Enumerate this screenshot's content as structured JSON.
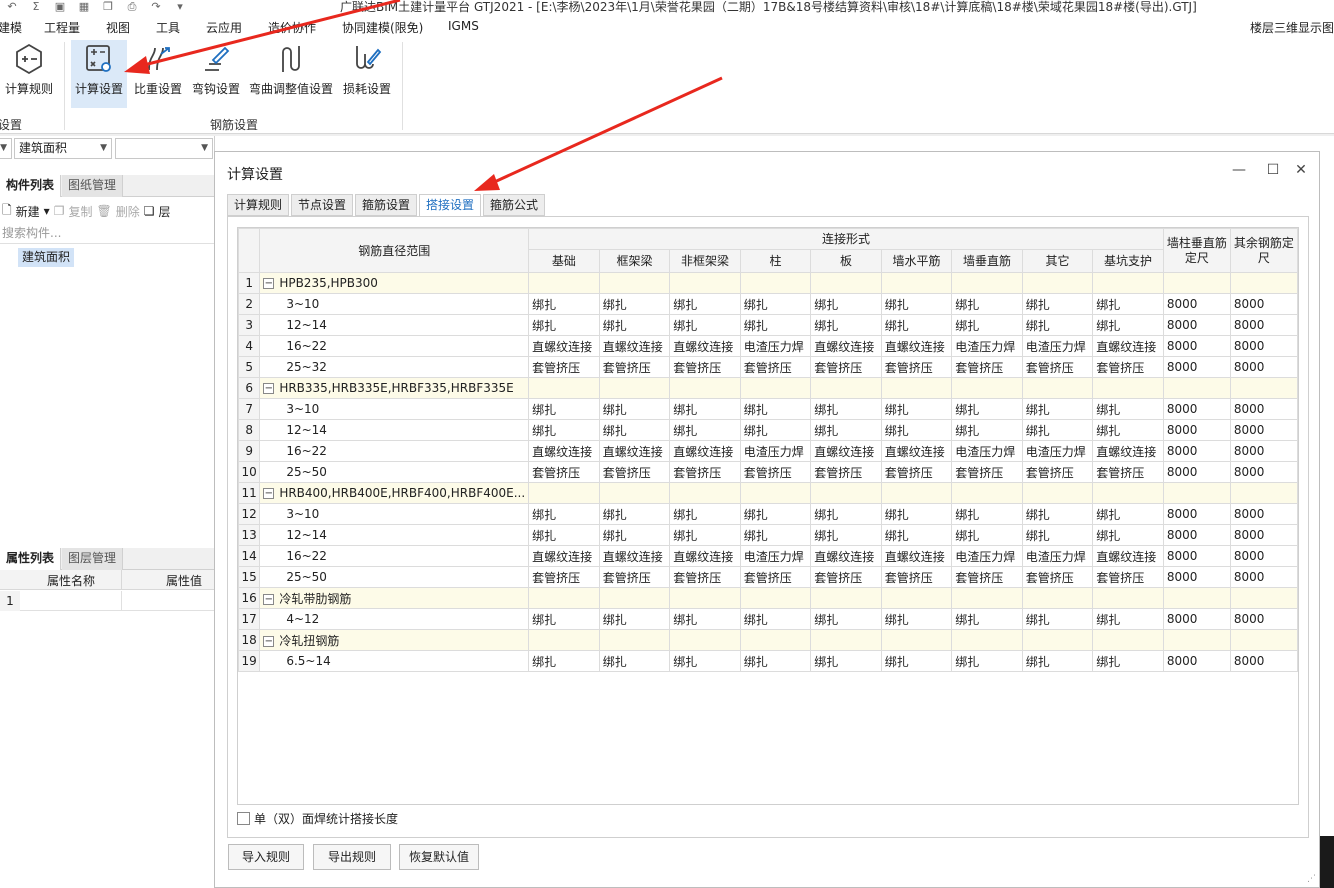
{
  "titlebar": {
    "app_title": "广联达BIM土建计量平台 GTJ2021 - [E:\\李杨\\2023年\\1月\\荣誉花果园（二期）17B&18号楼结算资料\\审核\\18#\\计算底稿\\18#楼\\荣域花果园18#楼(导出).GTJ]",
    "qa_icons": [
      "undo-icon",
      "sum-icon",
      "save-icon",
      "grid-icon",
      "copy-icon",
      "print-icon",
      "redo-icon",
      "dropdown-icon"
    ]
  },
  "menubar": {
    "items": [
      "建模",
      "工程量",
      "视图",
      "工具",
      "云应用",
      "造价协作",
      "协同建模(限免)",
      "IGMS"
    ],
    "right_label": "楼层三维显示图"
  },
  "ribbon": {
    "buttons": [
      {
        "label": "计算规则",
        "icon": "calc-rule-icon"
      },
      {
        "label": "计算设置",
        "icon": "calc-settings-icon"
      },
      {
        "label": "比重设置",
        "icon": "density-icon"
      },
      {
        "label": "弯钩设置",
        "icon": "hook-icon"
      },
      {
        "label": "弯曲调整值设置",
        "icon": "bend-icon"
      },
      {
        "label": "损耗设置",
        "icon": "loss-icon"
      }
    ],
    "group_left": "设置",
    "group_main": "钢筋设置"
  },
  "left_panel": {
    "combo1_value": "建筑面积",
    "tabs_top": [
      "构件列表",
      "图纸管理"
    ],
    "tools": {
      "new": "新建",
      "copy": "复制",
      "delete": "删除",
      "floor": "层"
    },
    "search_placeholder": "搜索构件...",
    "components": [
      "建筑面积"
    ],
    "tabs_bottom": [
      "属性列表",
      "图层管理"
    ],
    "attr_headers": [
      "属性名称",
      "属性值"
    ],
    "attr_rows": [
      "1"
    ]
  },
  "dialog": {
    "title": "计算设置",
    "tabs": [
      "计算规则",
      "节点设置",
      "箍筋设置",
      "搭接设置",
      "箍筋公式"
    ],
    "active_tab": "搭接设置",
    "table": {
      "col_range": "钢筋直径范围",
      "group_header": "连接形式",
      "connection_cols": [
        "基础",
        "框架梁",
        "非框架梁",
        "柱",
        "板",
        "墙水平筋",
        "墙垂直筋",
        "其它",
        "基坑支护"
      ],
      "col_wall_len": "墙柱垂直筋定尺",
      "col_other_len": "其余钢筋定尺",
      "rows": [
        {
          "n": "1",
          "group": true,
          "range": "HPB235,HPB300"
        },
        {
          "n": "2",
          "range": "3~10",
          "vals": [
            "绑扎",
            "绑扎",
            "绑扎",
            "绑扎",
            "绑扎",
            "绑扎",
            "绑扎",
            "绑扎",
            "绑扎"
          ],
          "wall": "8000",
          "other": "8000"
        },
        {
          "n": "3",
          "range": "12~14",
          "vals": [
            "绑扎",
            "绑扎",
            "绑扎",
            "绑扎",
            "绑扎",
            "绑扎",
            "绑扎",
            "绑扎",
            "绑扎"
          ],
          "wall": "8000",
          "other": "8000"
        },
        {
          "n": "4",
          "range": "16~22",
          "vals": [
            "直螺纹连接",
            "直螺纹连接",
            "直螺纹连接",
            "电渣压力焊",
            "直螺纹连接",
            "直螺纹连接",
            "电渣压力焊",
            "电渣压力焊",
            "直螺纹连接"
          ],
          "wall": "8000",
          "other": "8000"
        },
        {
          "n": "5",
          "range": "25~32",
          "vals": [
            "套管挤压",
            "套管挤压",
            "套管挤压",
            "套管挤压",
            "套管挤压",
            "套管挤压",
            "套管挤压",
            "套管挤压",
            "套管挤压"
          ],
          "wall": "8000",
          "other": "8000"
        },
        {
          "n": "6",
          "group": true,
          "range": "HRB335,HRB335E,HRBF335,HRBF335E"
        },
        {
          "n": "7",
          "range": "3~10",
          "vals": [
            "绑扎",
            "绑扎",
            "绑扎",
            "绑扎",
            "绑扎",
            "绑扎",
            "绑扎",
            "绑扎",
            "绑扎"
          ],
          "wall": "8000",
          "other": "8000"
        },
        {
          "n": "8",
          "range": "12~14",
          "vals": [
            "绑扎",
            "绑扎",
            "绑扎",
            "绑扎",
            "绑扎",
            "绑扎",
            "绑扎",
            "绑扎",
            "绑扎"
          ],
          "wall": "8000",
          "other": "8000"
        },
        {
          "n": "9",
          "range": "16~22",
          "vals": [
            "直螺纹连接",
            "直螺纹连接",
            "直螺纹连接",
            "电渣压力焊",
            "直螺纹连接",
            "直螺纹连接",
            "电渣压力焊",
            "电渣压力焊",
            "直螺纹连接"
          ],
          "wall": "8000",
          "other": "8000"
        },
        {
          "n": "10",
          "range": "25~50",
          "vals": [
            "套管挤压",
            "套管挤压",
            "套管挤压",
            "套管挤压",
            "套管挤压",
            "套管挤压",
            "套管挤压",
            "套管挤压",
            "套管挤压"
          ],
          "wall": "8000",
          "other": "8000"
        },
        {
          "n": "11",
          "group": true,
          "range": "HRB400,HRB400E,HRBF400,HRBF400E..."
        },
        {
          "n": "12",
          "range": "3~10",
          "vals": [
            "绑扎",
            "绑扎",
            "绑扎",
            "绑扎",
            "绑扎",
            "绑扎",
            "绑扎",
            "绑扎",
            "绑扎"
          ],
          "wall": "8000",
          "other": "8000"
        },
        {
          "n": "13",
          "range": "12~14",
          "vals": [
            "绑扎",
            "绑扎",
            "绑扎",
            "绑扎",
            "绑扎",
            "绑扎",
            "绑扎",
            "绑扎",
            "绑扎"
          ],
          "wall": "8000",
          "other": "8000"
        },
        {
          "n": "14",
          "range": "16~22",
          "vals": [
            "直螺纹连接",
            "直螺纹连接",
            "直螺纹连接",
            "电渣压力焊",
            "直螺纹连接",
            "直螺纹连接",
            "电渣压力焊",
            "电渣压力焊",
            "直螺纹连接"
          ],
          "wall": "8000",
          "other": "8000"
        },
        {
          "n": "15",
          "range": "25~50",
          "vals": [
            "套管挤压",
            "套管挤压",
            "套管挤压",
            "套管挤压",
            "套管挤压",
            "套管挤压",
            "套管挤压",
            "套管挤压",
            "套管挤压"
          ],
          "wall": "8000",
          "other": "8000"
        },
        {
          "n": "16",
          "group": true,
          "range": "冷轧带肋钢筋"
        },
        {
          "n": "17",
          "range": "4~12",
          "vals": [
            "绑扎",
            "绑扎",
            "绑扎",
            "绑扎",
            "绑扎",
            "绑扎",
            "绑扎",
            "绑扎",
            "绑扎"
          ],
          "wall": "8000",
          "other": "8000"
        },
        {
          "n": "18",
          "group": true,
          "range": "冷轧扭钢筋"
        },
        {
          "n": "19",
          "range": "6.5~14",
          "vals": [
            "绑扎",
            "绑扎",
            "绑扎",
            "绑扎",
            "绑扎",
            "绑扎",
            "绑扎",
            "绑扎",
            "绑扎"
          ],
          "wall": "8000",
          "other": "8000"
        }
      ]
    },
    "checkbox_label": "单（双）面焊统计搭接长度",
    "buttons": {
      "import": "导入规则",
      "export": "导出规则",
      "restore": "恢复默认值"
    }
  },
  "colors": {
    "accent": "#1f6fc0",
    "arrow": "#e8281e",
    "group_row": "#fdfbe8",
    "active_button": "#dbe9f8"
  }
}
